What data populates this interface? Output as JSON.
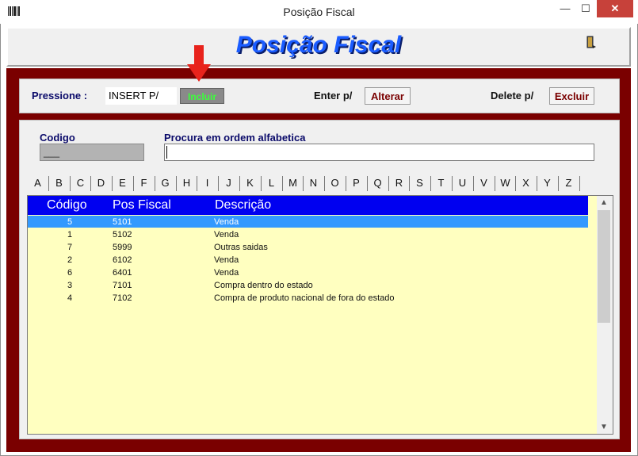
{
  "window": {
    "title": "Posição Fiscal",
    "min_label": "—",
    "max_label": "☐",
    "close_label": "✕"
  },
  "header": {
    "title": "Posição Fiscal"
  },
  "toolbar": {
    "pressione_label": "Pressione :",
    "insert_value": "INSERT P/",
    "incluir_label": "Incluir",
    "enter_label": "Enter p/",
    "alterar_label": "Alterar",
    "delete_label": "Delete p/",
    "excluir_label": "Excluir"
  },
  "search": {
    "codigo_label": "Codigo",
    "codigo_value": "___",
    "procura_label": "Procura em ordem alfabetica",
    "procura_value": ""
  },
  "tabs": [
    "A",
    "B",
    "C",
    "D",
    "E",
    "F",
    "G",
    "H",
    "I",
    "J",
    "K",
    "L",
    "M",
    "N",
    "O",
    "P",
    "Q",
    "R",
    "S",
    "T",
    "U",
    "V",
    "W",
    "X",
    "Y",
    "Z"
  ],
  "grid": {
    "headers": [
      "Código",
      "Pos Fiscal",
      "Descrição"
    ],
    "rows": [
      {
        "codigo": "5",
        "pos_fiscal": "5101",
        "descricao": "Venda"
      },
      {
        "codigo": "1",
        "pos_fiscal": "5102",
        "descricao": "Venda"
      },
      {
        "codigo": "7",
        "pos_fiscal": "5999",
        "descricao": "Outras saidas"
      },
      {
        "codigo": "2",
        "pos_fiscal": "6102",
        "descricao": "Venda"
      },
      {
        "codigo": "6",
        "pos_fiscal": "6401",
        "descricao": "Venda"
      },
      {
        "codigo": "3",
        "pos_fiscal": "7101",
        "descricao": "Compra dentro do estado"
      },
      {
        "codigo": "4",
        "pos_fiscal": "7102",
        "descricao": "Compra de produto nacional de fora do estado"
      }
    ]
  },
  "colors": {
    "frame": "#7a0000",
    "grid_header": "#0000f0",
    "grid_bg": "#ffffc0",
    "selected_row": "#3399ff",
    "title_blue": "#1a5cff",
    "incluir_text": "#3cff3c",
    "arrow": "#e8231c"
  },
  "icons": {
    "app": "barcode-icon",
    "exit": "exit-door-icon",
    "annotation": "red-down-arrow"
  }
}
